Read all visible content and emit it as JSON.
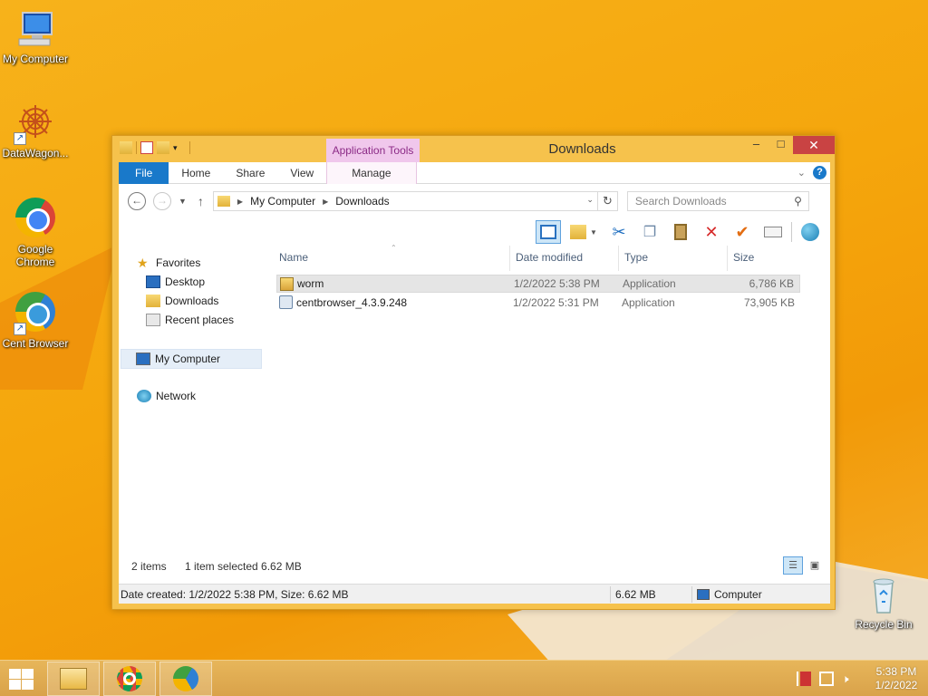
{
  "desktop": {
    "icons": [
      {
        "label": "My Computer"
      },
      {
        "label": "DataWagon..."
      },
      {
        "label": "Google\nChrome"
      },
      {
        "label": "Cent Browser"
      },
      {
        "label": "Recycle Bin"
      }
    ]
  },
  "window": {
    "title": "Downloads",
    "context_tab": "Application Tools",
    "controls": {
      "minimize": "–",
      "maximize": "□",
      "close": "✕"
    }
  },
  "ribbon": {
    "tabs": [
      "File",
      "Home",
      "Share",
      "View",
      "Manage"
    ]
  },
  "address": {
    "crumbs": [
      "My Computer",
      "Downloads"
    ],
    "search_placeholder": "Search Downloads"
  },
  "navpane": {
    "favorites": "Favorites",
    "desktop": "Desktop",
    "downloads": "Downloads",
    "recent": "Recent places",
    "computer": "My Computer",
    "network": "Network"
  },
  "columns": {
    "name": "Name",
    "date": "Date modified",
    "type": "Type",
    "size": "Size"
  },
  "files": [
    {
      "name": "worm",
      "date": "1/2/2022 5:38 PM",
      "type": "Application",
      "size": "6,786 KB"
    },
    {
      "name": "centbrowser_4.3.9.248",
      "date": "1/2/2022 5:31 PM",
      "type": "Application",
      "size": "73,905 KB"
    }
  ],
  "itembar": {
    "count": "2 items",
    "selected": "1 item selected  6.62 MB"
  },
  "statusbar": {
    "details": "Date created: 1/2/2022 5:38 PM, Size: 6.62 MB",
    "size": "6.62 MB",
    "location": "Computer"
  },
  "taskbar": {
    "time": "5:38 PM",
    "date": "1/2/2022"
  },
  "colors": {
    "accent": "#1979ca",
    "window_frame": "#f6c24c",
    "close": "#c94343",
    "context_tab": "#f0c7ec"
  }
}
